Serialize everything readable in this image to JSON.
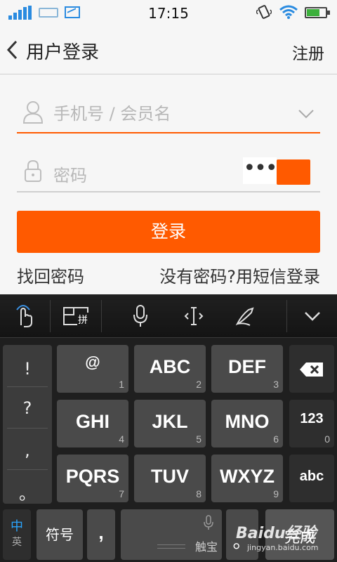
{
  "status_bar": {
    "time": "17:15"
  },
  "header": {
    "title": "用户登录",
    "register": "注册"
  },
  "form": {
    "username_placeholder": "手机号 / 会员名",
    "password_placeholder": "密码",
    "password_mask": "•••"
  },
  "actions": {
    "login": "登录",
    "forgot_password": "找回密码",
    "sms_login": "没有密码?用短信登录"
  },
  "colors": {
    "accent": "#ff5a00",
    "keyboard_bg": "#1f1f1f",
    "key_bg": "#4a4a4a"
  },
  "keyboard": {
    "toolbar_pinyin": "拼",
    "side_keys": [
      "!",
      "?",
      ",",
      "。"
    ],
    "keys": [
      {
        "label": "@",
        "num": "1"
      },
      {
        "label": "ABC",
        "num": "2"
      },
      {
        "label": "DEF",
        "num": "3"
      },
      {
        "label": "GHI",
        "num": "4"
      },
      {
        "label": "JKL",
        "num": "5"
      },
      {
        "label": "MNO",
        "num": "6"
      },
      {
        "label": "PQRS",
        "num": "7"
      },
      {
        "label": "TUV",
        "num": "8"
      },
      {
        "label": "WXYZ",
        "num": "9"
      }
    ],
    "num_key": {
      "label": "123",
      "num": "0"
    },
    "abc_key": "abc",
    "lang_key": {
      "main": "中",
      "sub": "英"
    },
    "symbol_key": "符号",
    "comma_key": ",",
    "space_label": "触宝",
    "period_key": "。",
    "done_key": "完成",
    "watermark": "Baidu经验",
    "watermark_url": "jingyan.baidu.com"
  }
}
